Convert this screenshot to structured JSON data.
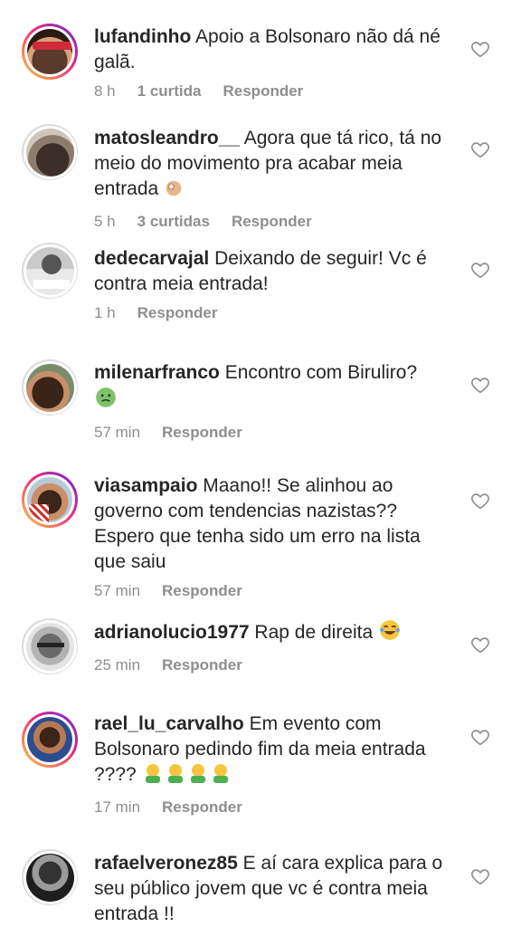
{
  "comments": [
    {
      "username": "lufandinho",
      "text": "Apoio a Bolsonaro não dá né galã.",
      "time": "8 h",
      "likes": "1 curtida",
      "reply": "Responder"
    },
    {
      "username": "matosleandro__",
      "text": "Agora que tá rico, tá no meio do movimento pra acabar meia entrada",
      "time": "5 h",
      "likes": "3 curtidas",
      "reply": "Responder"
    },
    {
      "username": "dedecarvajal",
      "text": "Deixando de seguir! Vc é contra meia entrada!",
      "time": "1 h",
      "likes": "",
      "reply": "Responder"
    },
    {
      "username": "milenarfranco",
      "text": "Encontro com Biruliro?",
      "time": "57 min",
      "likes": "",
      "reply": "Responder"
    },
    {
      "username": "viasampaio",
      "text": "Maano!! Se alinhou ao governo com tendencias nazistas?? Espero que tenha sido um erro na lista que saiu",
      "time": "57 min",
      "likes": "",
      "reply": "Responder"
    },
    {
      "username": "adrianolucio1977",
      "text": "Rap de direita",
      "time": "25 min",
      "likes": "",
      "reply": "Responder"
    },
    {
      "username": "rael_lu_carvalho",
      "text": "Em evento com Bolsonaro pedindo fim da meia entrada ????",
      "time": "17 min",
      "likes": "",
      "reply": "Responder"
    },
    {
      "username": "rafaelveronez85",
      "text": "E aí cara explica para o seu público jovem que vc é contra meia entrada !!",
      "time": "",
      "likes": "",
      "reply": ""
    }
  ],
  "icons": {
    "like": "heart-outline-icon"
  },
  "colors": {
    "text": "#262626",
    "meta": "#8e8e8e"
  }
}
